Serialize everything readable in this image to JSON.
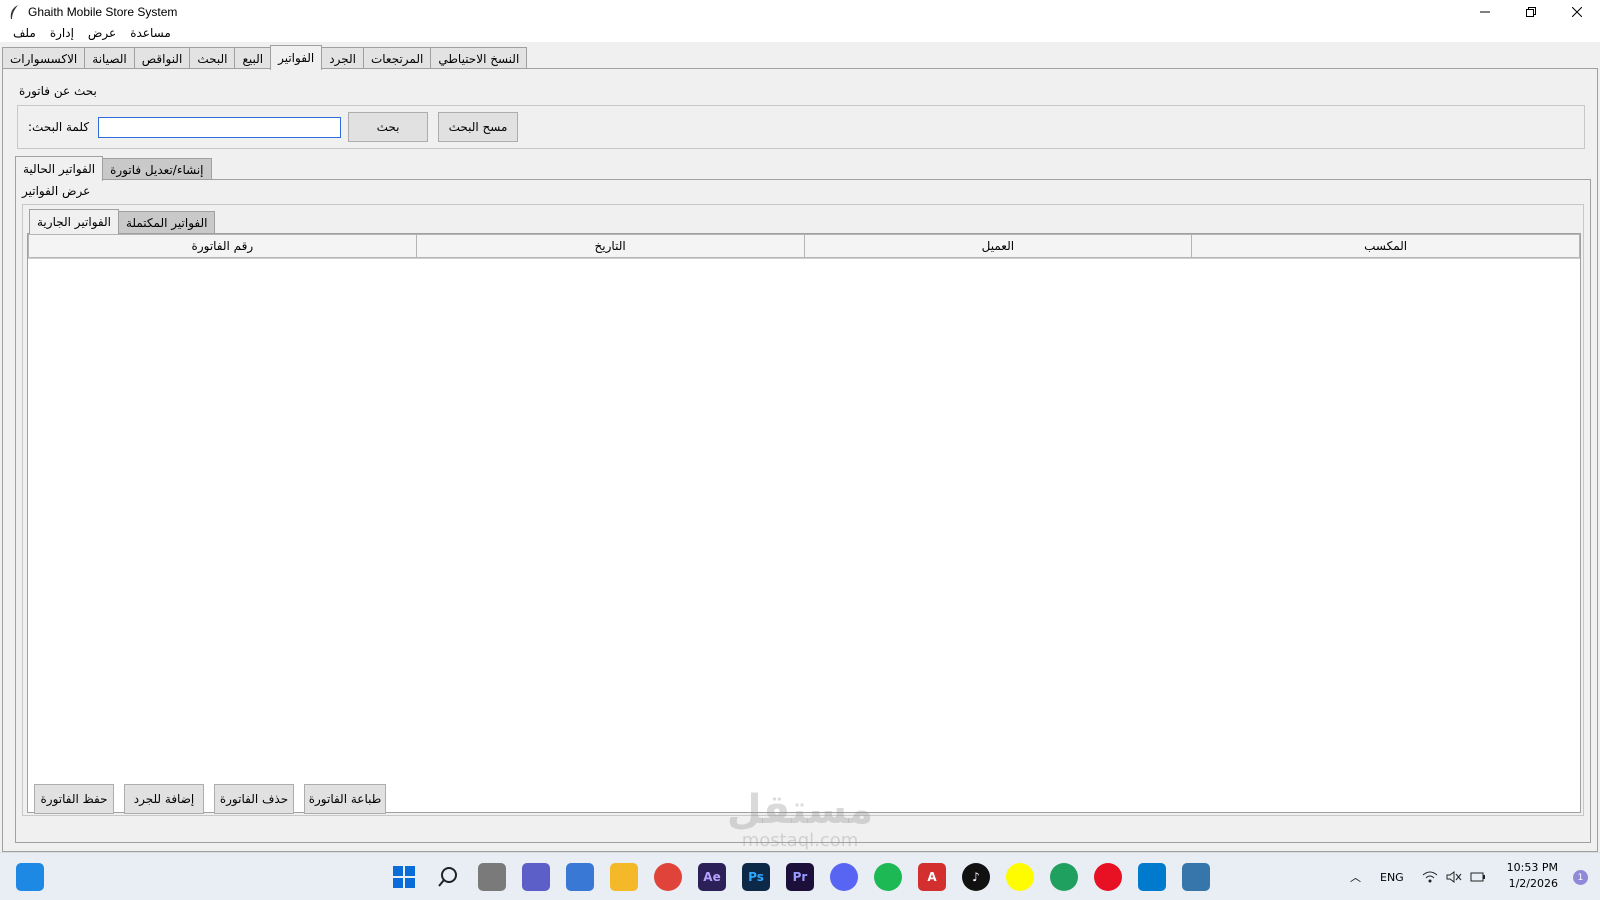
{
  "window": {
    "title": "Ghaith Mobile Store System"
  },
  "menu": [
    "مساعدة",
    "عرض",
    "إدارة",
    "ملف"
  ],
  "main_tabs": [
    "الاكسسوارات",
    "الصيانة",
    "النواقص",
    "البحث",
    "البيع",
    "الفواتير",
    "الجرد",
    "المرتجعات",
    "النسخ الاحتياطي"
  ],
  "main_tab_active": "الفواتير",
  "search": {
    "frame_title": "بحث عن فاتورة",
    "label": ":كلمة البحث",
    "value": "",
    "search_button": "بحث",
    "clear_button": "مسح البحث"
  },
  "sub_tabs": [
    "الفواتير الحالية",
    "إنشاء/تعديل فاتورة"
  ],
  "invoices": {
    "frame_title": "عرض الفواتير",
    "inner_tabs": [
      "الفواتير الجارية",
      "الفواتير المكتملة"
    ],
    "columns": [
      "رقم الفاتورة",
      "التاريخ",
      "العميل",
      "المكسب"
    ],
    "rows": []
  },
  "actions": {
    "save": "حفظ الفاتورة",
    "add_inventory": "إضافة للجرد",
    "delete": "حذف الفاتورة",
    "print": "طباعة الفاتورة"
  },
  "watermark": "mostaql.com",
  "taskbar": {
    "lang": "ENG",
    "time": "10:53 PM",
    "date": "1/2/2026",
    "notifications": "1"
  }
}
